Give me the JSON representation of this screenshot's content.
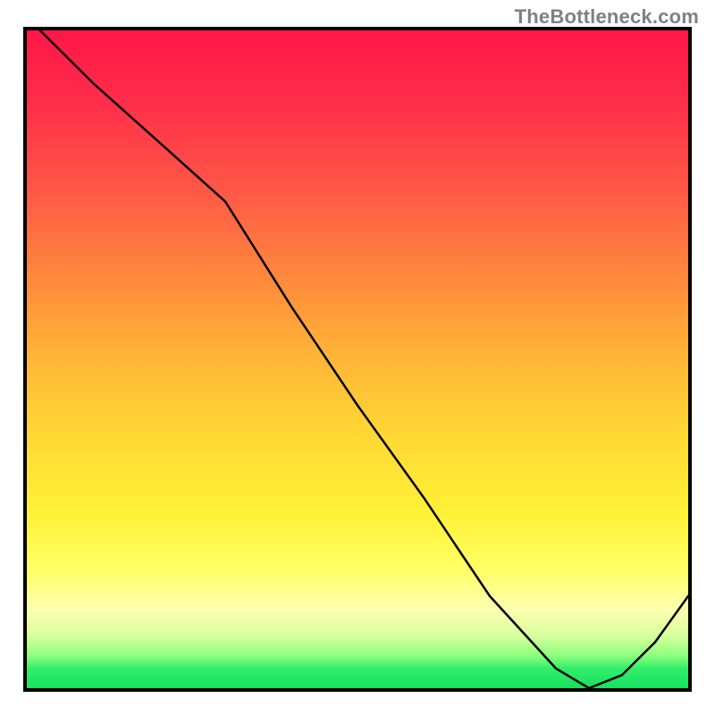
{
  "watermark": "TheBottleneck.com",
  "baseline_label": "",
  "chart_data": {
    "type": "line",
    "title": "",
    "xlabel": "",
    "ylabel": "",
    "xlim": [
      0,
      100
    ],
    "ylim": [
      0,
      100
    ],
    "grid": false,
    "legend": false,
    "series": [
      {
        "name": "curve",
        "color": "#000000",
        "x": [
          2,
          10,
          20,
          30,
          40,
          50,
          60,
          70,
          80,
          85,
          90,
          95,
          100
        ],
        "values": [
          100,
          92,
          83,
          74,
          58,
          43,
          29,
          14,
          3,
          0,
          2,
          7,
          14
        ]
      }
    ],
    "annotations": [
      {
        "text": "",
        "x": 82,
        "y": 1.2,
        "color": "#d63e20"
      }
    ]
  }
}
